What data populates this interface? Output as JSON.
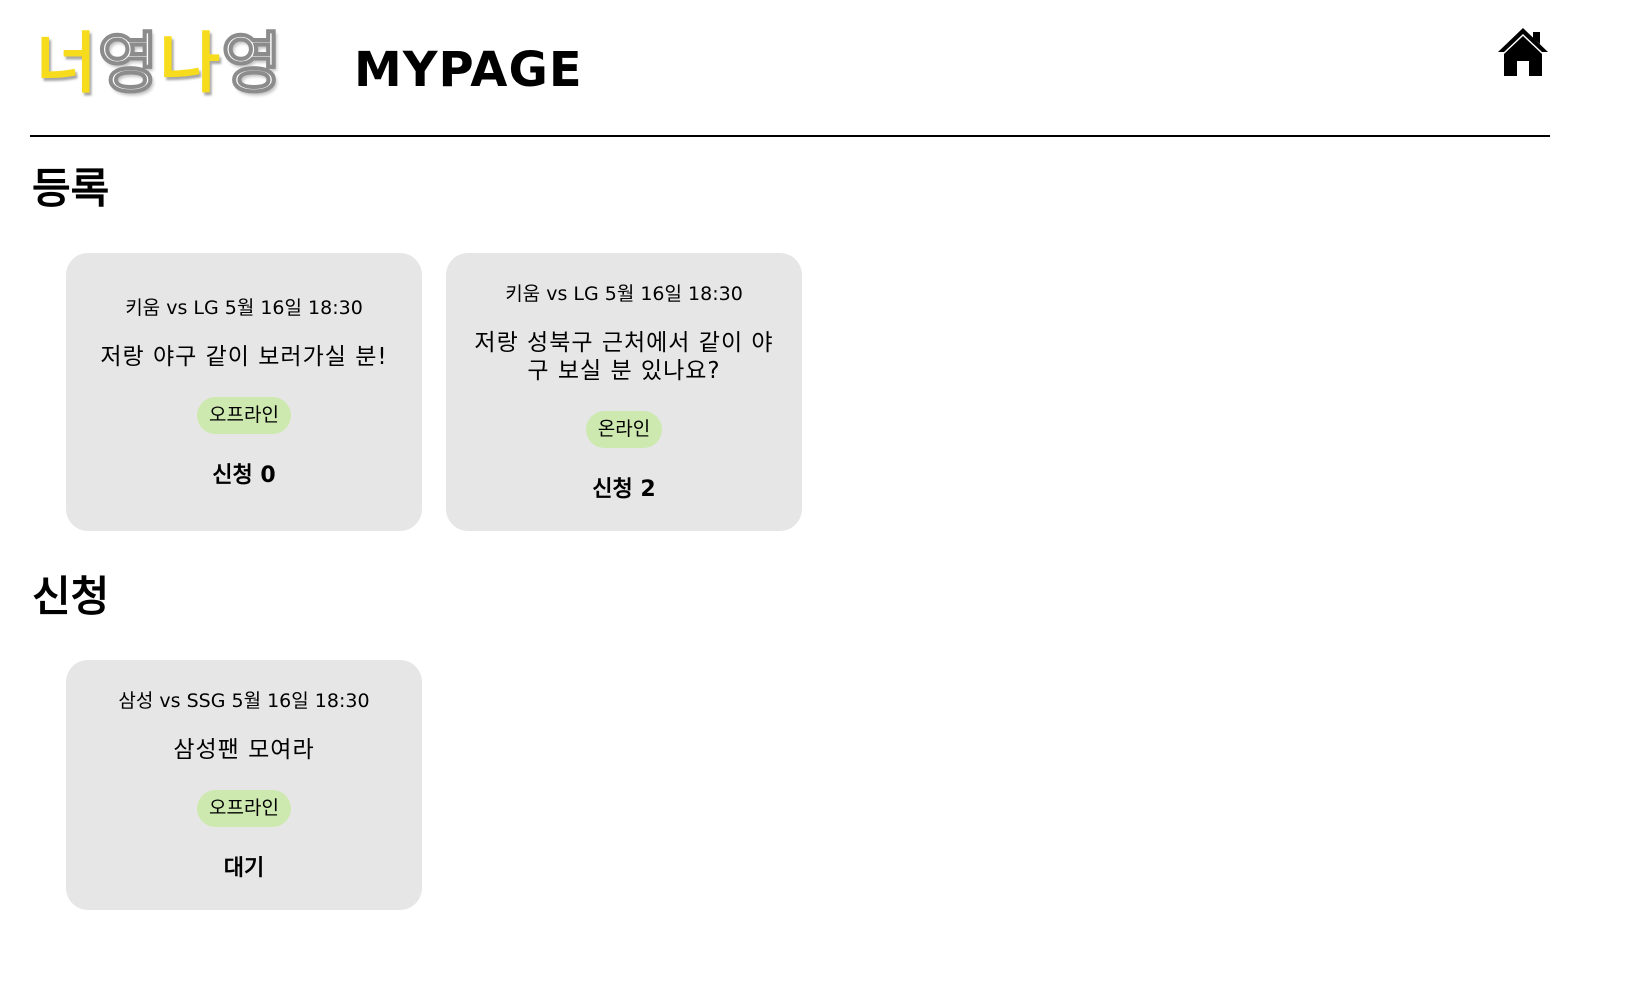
{
  "header": {
    "logo": {
      "char1": "너",
      "char2": "영",
      "char3": "나",
      "char4": "영"
    },
    "title": "MYPAGE",
    "home_icon": "home-icon"
  },
  "sections": [
    {
      "title": "등록",
      "cards": [
        {
          "meta": "키움 vs LG 5월 16일 18:30",
          "title": "저랑 야구 같이 보러가실 분!",
          "badge": "오프라인",
          "status": "신청 0"
        },
        {
          "meta": "키움 vs LG 5월 16일 18:30",
          "title": "저랑 성북구 근처에서 같이 야구 보실 분 있나요?",
          "badge": "온라인",
          "status": "신청 2"
        }
      ]
    },
    {
      "title": "신청",
      "cards": [
        {
          "meta": "삼성 vs SSG 5월 16일 18:30",
          "title": "삼성팬 모여라",
          "badge": "오프라인",
          "status": "대기"
        }
      ]
    }
  ],
  "colors": {
    "logo_yellow": "#f7dc1e",
    "card_background": "#e6e6e6",
    "badge_background": "#cde9b0"
  }
}
